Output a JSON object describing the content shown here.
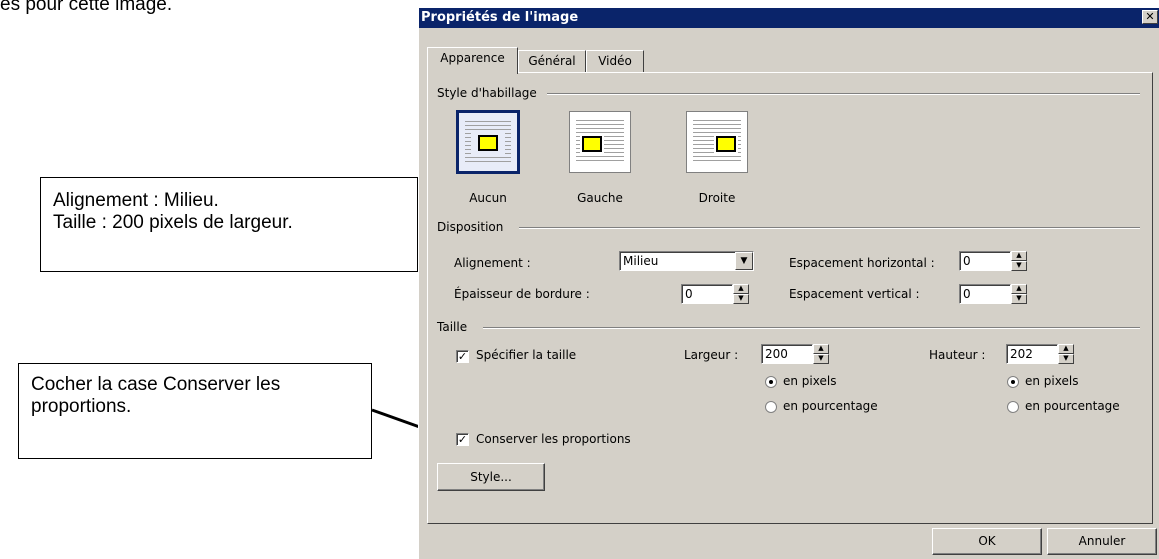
{
  "doc": {
    "top_text": "es pour cette image.",
    "callout1": {
      "line1": "Alignement : Milieu.",
      "line2": "Taille : 200 pixels de largeur."
    },
    "callout2": {
      "line1": "Cocher la case Conserver les",
      "line2": "proportions."
    }
  },
  "dialog": {
    "title": "Propriétés de l'image",
    "close_glyph": "✕",
    "tabs": [
      {
        "label": "Apparence",
        "active": true
      },
      {
        "label": "Général",
        "active": false
      },
      {
        "label": "Vidéo",
        "active": false
      }
    ],
    "wrap": {
      "group_label": "Style d'habillage",
      "options": [
        {
          "label": "Aucun",
          "selected": true
        },
        {
          "label": "Gauche",
          "selected": false
        },
        {
          "label": "Droite",
          "selected": false
        }
      ]
    },
    "layout": {
      "group_label": "Disposition",
      "alignment_label": "Alignement :",
      "alignment_value": "Milieu",
      "border_label": "Épaisseur de bordure :",
      "border_value": "0",
      "hspace_label": "Espacement horizontal :",
      "hspace_value": "0",
      "vspace_label": "Espacement vertical :",
      "vspace_value": "0"
    },
    "size": {
      "group_label": "Taille",
      "specify_label": "Spécifier la taille",
      "specify_checked": true,
      "width_label": "Largeur :",
      "width_value": "200",
      "height_label": "Hauteur :",
      "height_value": "202",
      "pixels_label": "en pixels",
      "percent_label": "en pourcentage",
      "keep_ratio_label": "Conserver les proportions",
      "keep_ratio_checked": true
    },
    "style_button": "Style...",
    "ok_button": "OK",
    "cancel_button": "Annuler"
  },
  "colors": {
    "titlebar": "#0a246a",
    "dialog_bg": "#d4d0c8",
    "wrap_image": "#ffff00"
  }
}
